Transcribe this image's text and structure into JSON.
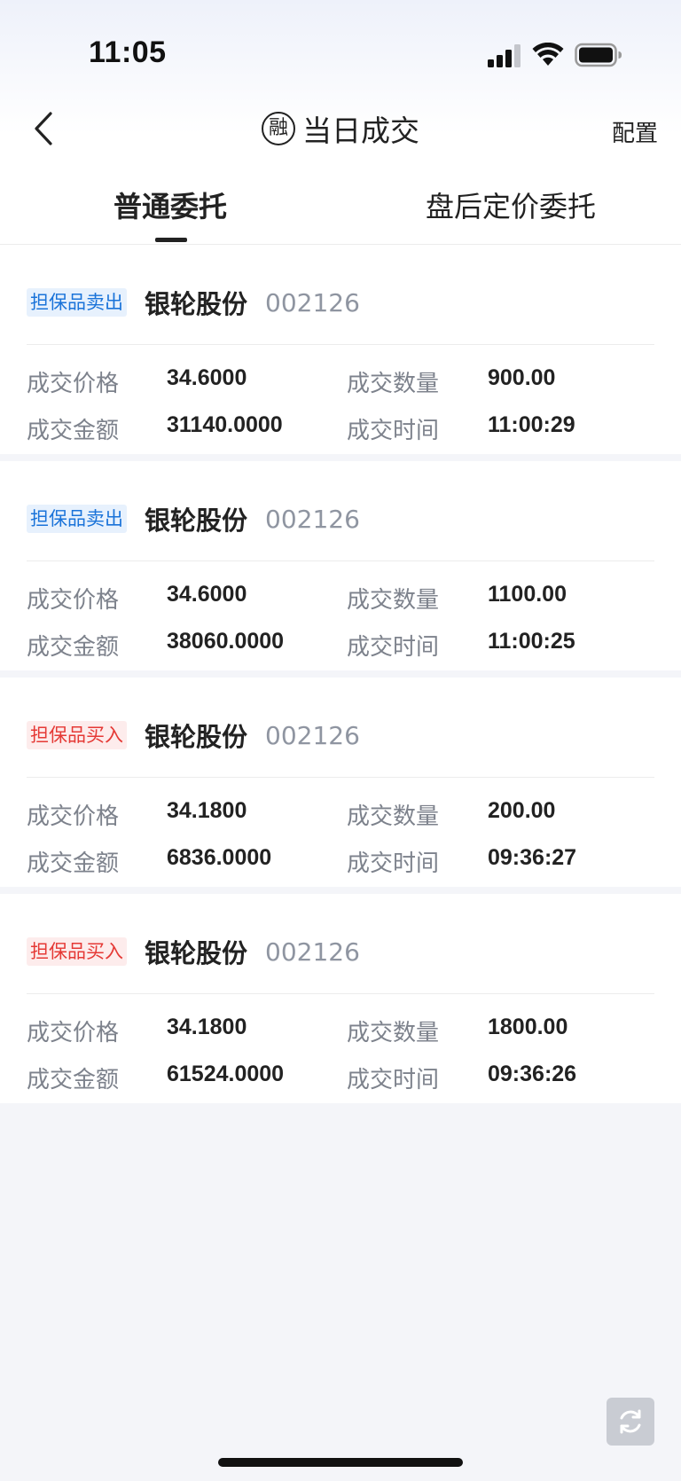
{
  "status_bar": {
    "time": "11:05"
  },
  "header": {
    "title_icon_char": "融",
    "title": "当日成交",
    "config_label": "配置"
  },
  "tabs": [
    {
      "label": "普通委托",
      "active": true
    },
    {
      "label": "盘后定价委托",
      "active": false
    }
  ],
  "labels": {
    "price": "成交价格",
    "quantity": "成交数量",
    "amount": "成交金额",
    "time": "成交时间"
  },
  "trades": [
    {
      "tag": "担保品卖出",
      "side": "sell",
      "name": "银轮股份",
      "code": "002126",
      "price": "34.6000",
      "quantity": "900.00",
      "amount": "31140.0000",
      "time": "11:00:29"
    },
    {
      "tag": "担保品卖出",
      "side": "sell",
      "name": "银轮股份",
      "code": "002126",
      "price": "34.6000",
      "quantity": "1100.00",
      "amount": "38060.0000",
      "time": "11:00:25"
    },
    {
      "tag": "担保品买入",
      "side": "buy",
      "name": "银轮股份",
      "code": "002126",
      "price": "34.1800",
      "quantity": "200.00",
      "amount": "6836.0000",
      "time": "09:36:27"
    },
    {
      "tag": "担保品买入",
      "side": "buy",
      "name": "银轮股份",
      "code": "002126",
      "price": "34.1800",
      "quantity": "1800.00",
      "amount": "61524.0000",
      "time": "09:36:26"
    }
  ],
  "colors": {
    "sell": "#1a73d9",
    "buy": "#e53935",
    "background": "#f4f5f9"
  },
  "icons": {
    "back": "chevron-left-icon",
    "refresh": "refresh-icon"
  }
}
